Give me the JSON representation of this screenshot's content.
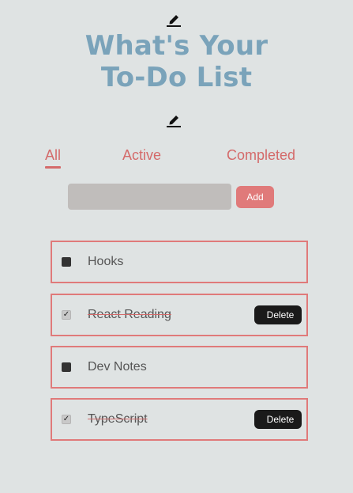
{
  "header": {
    "title_line1": "What's Your",
    "title_line2": "To-Do List",
    "top_icon": "pencil-icon",
    "mid_icon": "pencil-icon"
  },
  "filters": [
    {
      "label": "All",
      "active": true
    },
    {
      "label": "Active",
      "active": false
    },
    {
      "label": "Completed",
      "active": false
    }
  ],
  "new_todo": {
    "value": "",
    "placeholder": "",
    "add_label": "Add"
  },
  "todos": [
    {
      "text": "Hooks",
      "completed": false
    },
    {
      "text": "React Reading",
      "completed": true,
      "delete_label": "Delete"
    },
    {
      "text": "Dev Notes",
      "completed": false
    },
    {
      "text": "TypeScript",
      "completed": true,
      "delete_label": "Delete"
    }
  ],
  "colors": {
    "background": "#dfe3e3",
    "title": "#7aa3ba",
    "accent": "#e07a7a",
    "tab_text": "#d46a6a",
    "delete_bg": "#1a1a1a"
  }
}
